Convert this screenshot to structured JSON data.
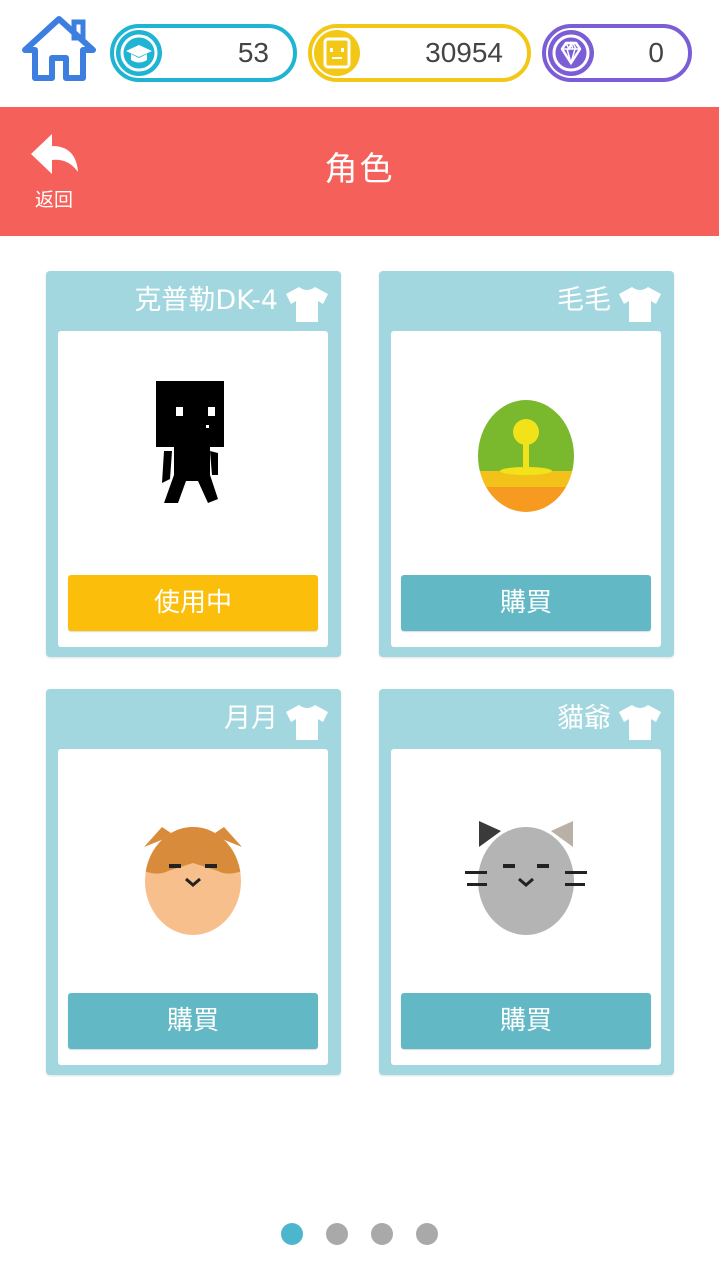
{
  "topbar": {
    "level": {
      "icon": "graduation-cap-icon",
      "value": "53",
      "color": "#1fb4d3"
    },
    "coins": {
      "icon": "coin-face-icon",
      "value": "30954",
      "color": "#f3c715"
    },
    "gems": {
      "icon": "diamond-icon",
      "value": "0",
      "color": "#7b5ed6"
    }
  },
  "header": {
    "back_label": "返回",
    "title": "角色",
    "background": "#f5615a"
  },
  "cards": [
    {
      "name": "克普勒DK-4",
      "button": "使用中",
      "state": "in-use",
      "avatar": "black-pixel-robot"
    },
    {
      "name": "毛毛",
      "button": "購買",
      "state": "buy",
      "avatar": "green-orange-egg"
    },
    {
      "name": "月月",
      "button": "購買",
      "state": "buy",
      "avatar": "shiba-dog-egg"
    },
    {
      "name": "貓爺",
      "button": "購買",
      "state": "buy",
      "avatar": "grey-cat-egg"
    }
  ],
  "pager": {
    "pages": 4,
    "current": 1
  },
  "colors": {
    "card_bg": "#a3d7df",
    "in_use": "#fbbf0b",
    "buy": "#62b8c4",
    "dot_active": "#4db6cf",
    "dot": "#a9a9a9"
  }
}
